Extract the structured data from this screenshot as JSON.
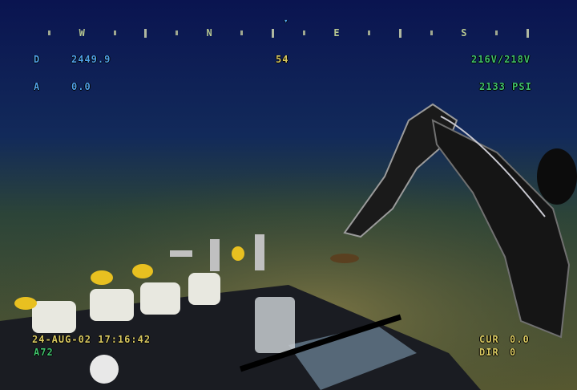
{
  "compass": {
    "pointer": "▾",
    "labels": [
      "W",
      "N",
      "E",
      "S"
    ]
  },
  "depth": {
    "label": "D",
    "value": "2449.9"
  },
  "altitude": {
    "label": "A",
    "value": "0.0"
  },
  "heading": "54",
  "voltage": "216V/218V",
  "pressure": "2133 PSI",
  "timestamp": "24-AUG-02 17:16:42",
  "camera_id": "A72",
  "current": {
    "label": "CUR",
    "value": "0.0"
  },
  "direction": {
    "label": "DIR",
    "value": "0"
  }
}
